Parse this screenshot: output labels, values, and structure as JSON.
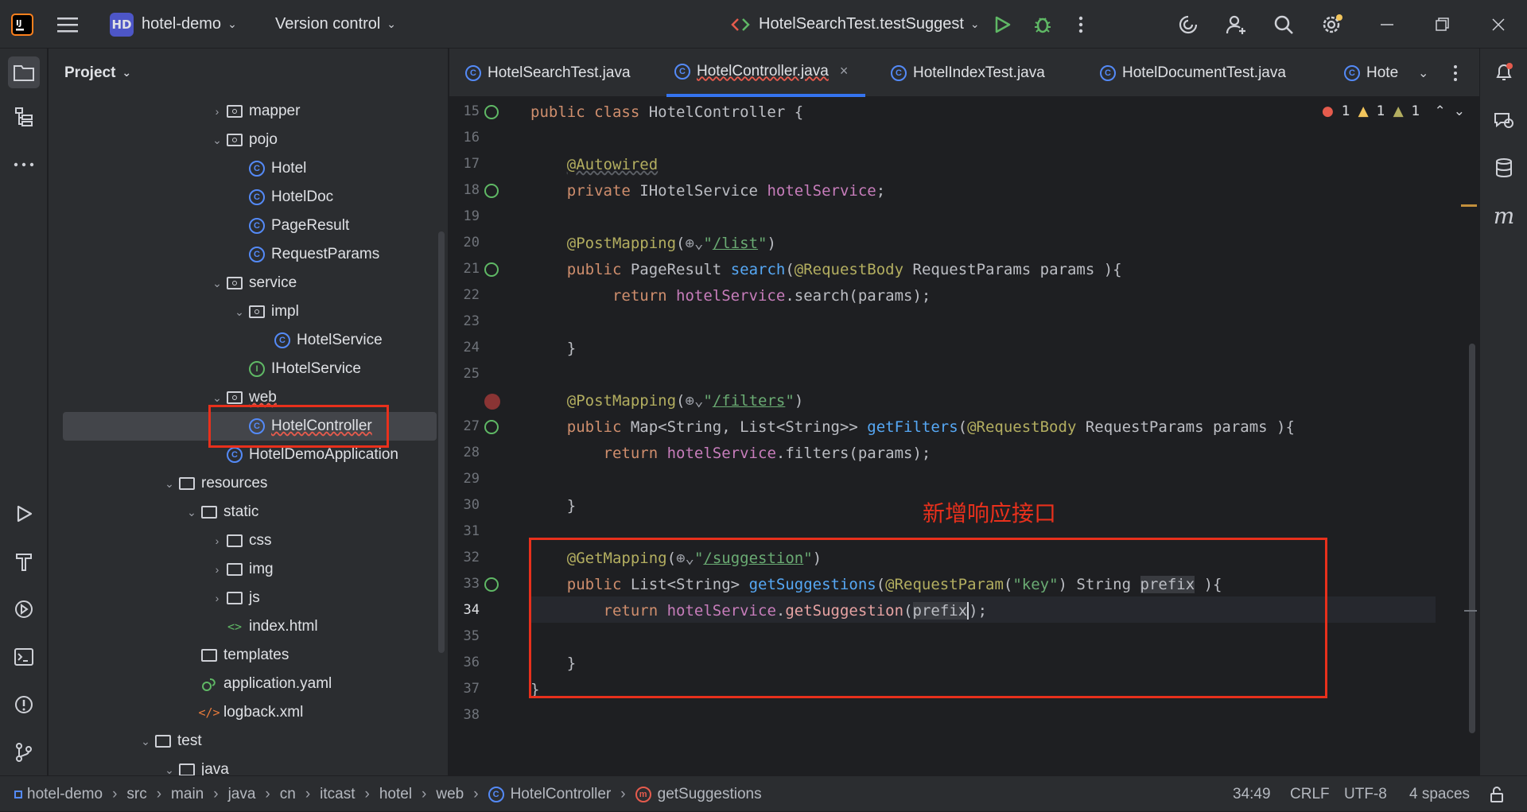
{
  "toolbar": {
    "project_badge": "HD",
    "project_name": "hotel-demo",
    "vcs_label": "Version control",
    "run_config": "HotelSearchTest.testSuggest"
  },
  "project_panel": {
    "title": "Project",
    "tree": [
      {
        "label": "mapper",
        "type": "package",
        "expanded": false
      },
      {
        "label": "pojo",
        "type": "package",
        "expanded": true
      },
      {
        "label": "Hotel",
        "type": "class"
      },
      {
        "label": "HotelDoc",
        "type": "class"
      },
      {
        "label": "PageResult",
        "type": "class"
      },
      {
        "label": "RequestParams",
        "type": "class"
      },
      {
        "label": "service",
        "type": "package",
        "expanded": true
      },
      {
        "label": "impl",
        "type": "package",
        "expanded": true
      },
      {
        "label": "HotelService",
        "type": "class"
      },
      {
        "label": "IHotelService",
        "type": "interface"
      },
      {
        "label": "web",
        "type": "package",
        "expanded": true
      },
      {
        "label": "HotelController",
        "type": "class",
        "selected": true
      },
      {
        "label": "HotelDemoApplication",
        "type": "class"
      },
      {
        "label": "resources",
        "type": "folder",
        "expanded": true
      },
      {
        "label": "static",
        "type": "folder",
        "expanded": true
      },
      {
        "label": "css",
        "type": "folder",
        "expanded": false
      },
      {
        "label": "img",
        "type": "folder",
        "expanded": false
      },
      {
        "label": "js",
        "type": "folder",
        "expanded": false
      },
      {
        "label": "index.html",
        "type": "html"
      },
      {
        "label": "templates",
        "type": "folder"
      },
      {
        "label": "application.yaml",
        "type": "yaml"
      },
      {
        "label": "logback.xml",
        "type": "xml"
      },
      {
        "label": "test",
        "type": "folder",
        "expanded": true
      },
      {
        "label": "java",
        "type": "folder",
        "expanded": true
      }
    ]
  },
  "tabs": [
    {
      "label": "HotelSearchTest.java"
    },
    {
      "label": "HotelController.java",
      "active": true
    },
    {
      "label": "HotelIndexTest.java"
    },
    {
      "label": "HotelDocumentTest.java"
    },
    {
      "label": "Hote"
    }
  ],
  "inspections": {
    "errors": "1",
    "warnings": "1",
    "weak_warnings": "1"
  },
  "code": {
    "line_numbers": [
      "15",
      "16",
      "17",
      "18",
      "19",
      "20",
      "21",
      "22",
      "23",
      "24",
      "25",
      "",
      "27",
      "28",
      "29",
      "30",
      "31",
      "32",
      "33",
      "34",
      "35",
      "36",
      "37",
      "38"
    ]
  },
  "annotation_text": "新增响应接口",
  "statusbar": {
    "breadcrumb": [
      "hotel-demo",
      "src",
      "main",
      "java",
      "cn",
      "itcast",
      "hotel",
      "web",
      "HotelController",
      "getSuggestions"
    ],
    "position": "34:49",
    "line_sep": "CRLF",
    "encoding": "UTF-8",
    "indent": "4 spaces"
  },
  "colors": {
    "accent": "#3574f0",
    "highlight_box": "#e8301c",
    "class_icon": "#548af7"
  }
}
